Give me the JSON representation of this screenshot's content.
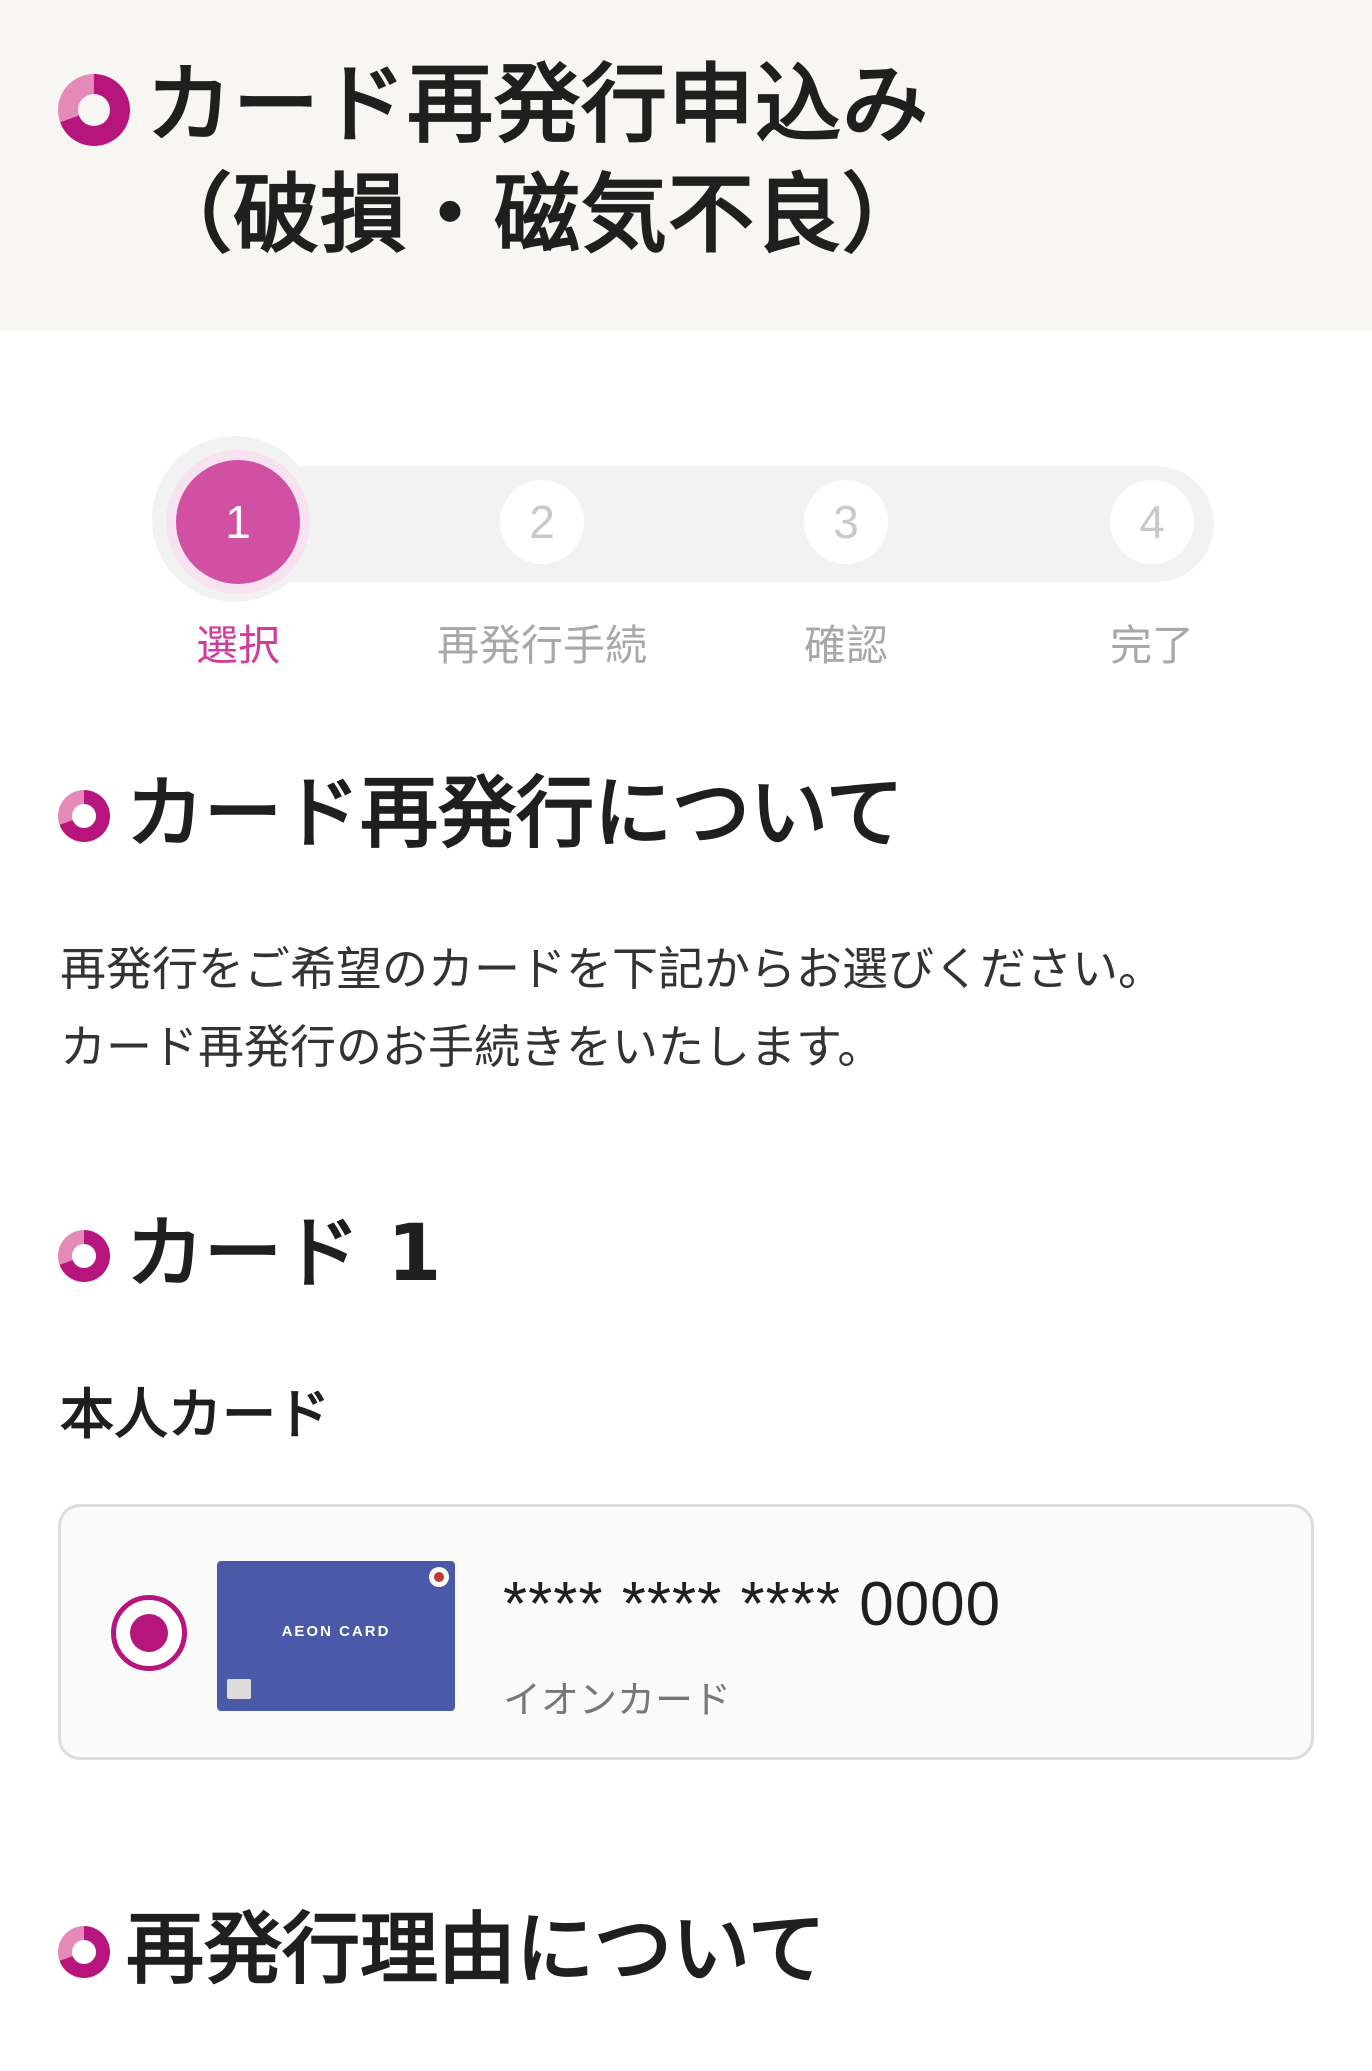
{
  "header": {
    "title_line1": "カード再発行申込み",
    "title_line2": "（破損・磁気不良）"
  },
  "stepper": {
    "steps": [
      {
        "number": "1",
        "label": "選択"
      },
      {
        "number": "2",
        "label": "再発行手続"
      },
      {
        "number": "3",
        "label": "確認"
      },
      {
        "number": "4",
        "label": "完了"
      }
    ],
    "current_step": 1
  },
  "about": {
    "heading": "カード再発行について",
    "description_line1": "再発行をご希望のカードを下記からお選びください。",
    "description_line2": "カード再発行のお手続きをいたします。"
  },
  "card_section": {
    "heading": "カード 1",
    "subheading": "本人カード",
    "card": {
      "brand": "AEON CARD",
      "number": "**** **** **** 0000",
      "name": "イオンカード",
      "selected": true
    }
  },
  "reason": {
    "heading": "再発行理由について"
  },
  "colors": {
    "accent": "#b5157d",
    "step_active": "#d150a4",
    "header_bg": "#f8f6f2",
    "card_blue": "#4a5aa8"
  }
}
